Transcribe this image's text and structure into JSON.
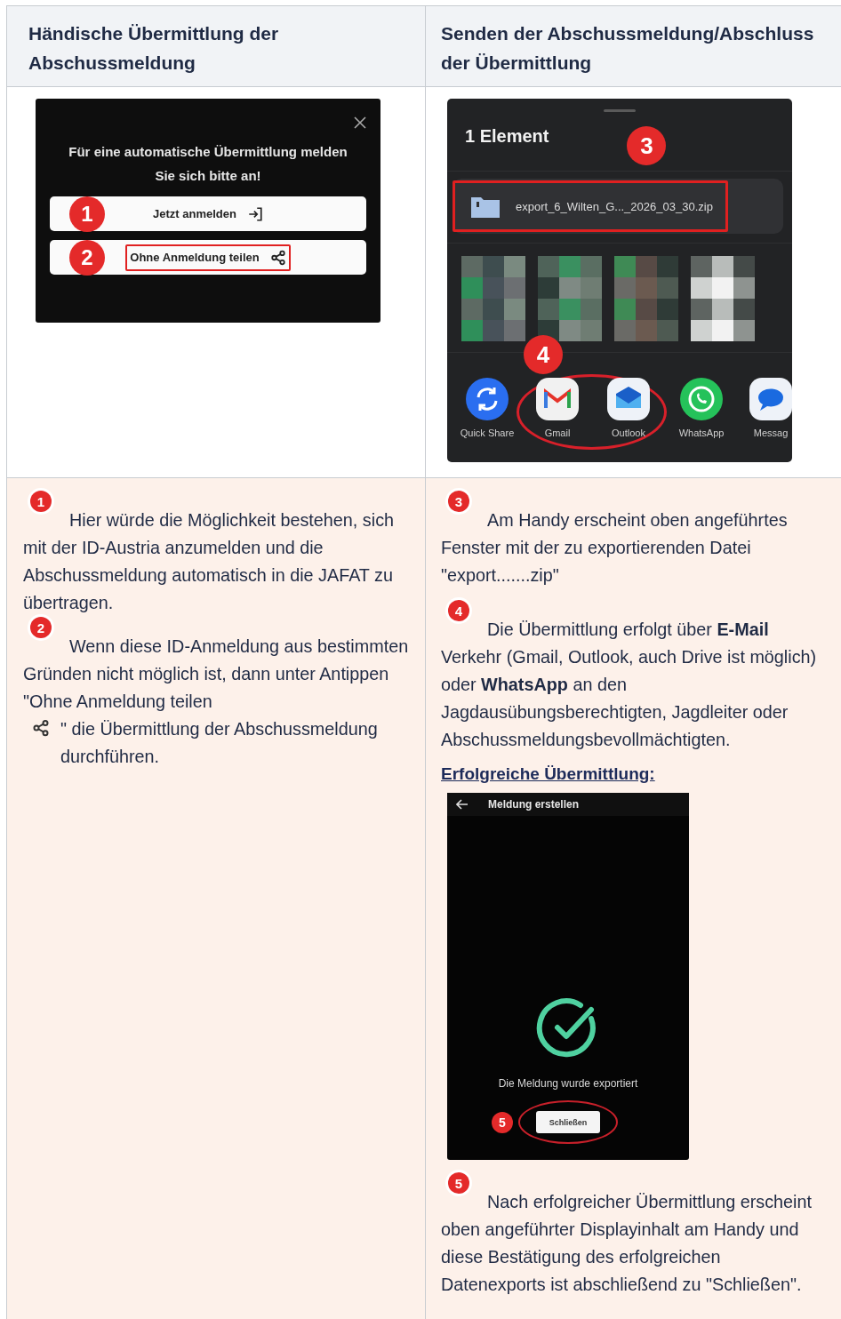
{
  "table": {
    "columns": [
      {
        "heading": "Händische Übermittlung der Abschussmeldung"
      },
      {
        "heading": "Senden der Abschussmeldung/Abschluss der Übermittlung"
      }
    ],
    "login_dialog": {
      "message": "Für eine automatische Übermittlung melden Sie sich bitte an!",
      "buttons": [
        {
          "marker": "1",
          "label": "Jetzt anmelden",
          "kind": "login",
          "highlighted": false
        },
        {
          "marker": "2",
          "label": "Ohne Anmeldung teilen",
          "kind": "share",
          "highlighted": true
        }
      ]
    },
    "share_sheet": {
      "title": "1 Element",
      "marker": "3",
      "file": {
        "name": "export_6_Wilten_G..._2026_03_30.zip",
        "highlighted": true
      },
      "apps_marker": "4",
      "apps": [
        {
          "label": "Quick Share",
          "kind": "sync",
          "circled": false
        },
        {
          "label": "Gmail",
          "kind": "mail",
          "circled": true
        },
        {
          "label": "Outlook",
          "kind": "envelope",
          "circled": true
        },
        {
          "label": "WhatsApp",
          "kind": "phone",
          "circled": false
        },
        {
          "label": "Messag",
          "kind": "chat",
          "circled": false
        }
      ]
    },
    "left_notes": [
      {
        "marker": "1",
        "text": "Hier würde die Möglichkeit bestehen, sich mit der ID-Austria anzumelden und die Abschussmeldung automatisch in die JAFAT zu übertragen."
      },
      {
        "marker": "2",
        "text": "Wenn diese ID-Anmeldung aus bestimmten Gründen nicht möglich ist, dann unter Antippen  \"Ohne Anmeldung teilen",
        "after_icon": "\" die Übermittlung der Abschussmeldung durchführen."
      }
    ],
    "right_notes": [
      {
        "marker": "3",
        "text": "Am Handy erscheint oben angeführtes Fenster mit der zu exportierenden Datei \"export.......zip\""
      },
      {
        "marker": "4",
        "text": "Die Übermittlung erfolgt über **E-Mail** Verkehr (Gmail, Outlook, auch Drive ist möglich) oder **WhatsApp** an den Jagdausübungsberechtigten, Jagdleiter oder Abschussmeldungsbevollmächtigten."
      }
    ],
    "success_heading": "Erfolgreiche Übermittlung:",
    "success_screen": {
      "title": "Meldung erstellen",
      "message": "Die Meldung wurde exportiert",
      "marker": "5",
      "button": {
        "label": "Schließen",
        "circled": true
      }
    },
    "final_note": {
      "marker": "5",
      "text": "Nach erfolgreicher Übermittlung erscheint oben angeführter Displayinhalt am Handy und diese Bestätigung des erfolgreichen Datenexports ist abschließend zu \"Schließen\"."
    }
  }
}
